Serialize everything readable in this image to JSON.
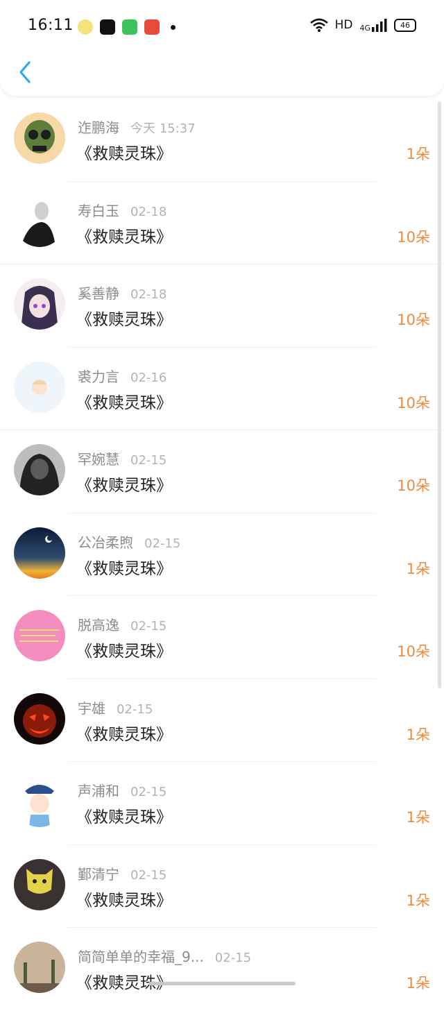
{
  "status_bar": {
    "time": "16:11",
    "hd": "HD",
    "network": "4G",
    "battery": "46"
  },
  "colors": {
    "accent": "#2aa8f2",
    "amount": "#f08a3a"
  },
  "records": [
    {
      "name": "迮鹏海",
      "date": "今天 15:37",
      "book": "《救赎灵珠》",
      "amount": "1朵"
    },
    {
      "name": "寿白玉",
      "date": "02-18",
      "book": "《救赎灵珠》",
      "amount": "10朵"
    },
    {
      "name": "奚善静",
      "date": "02-18",
      "book": "《救赎灵珠》",
      "amount": "10朵"
    },
    {
      "name": "裘力言",
      "date": "02-16",
      "book": "《救赎灵珠》",
      "amount": "10朵"
    },
    {
      "name": "罕婉慧",
      "date": "02-15",
      "book": "《救赎灵珠》",
      "amount": "10朵"
    },
    {
      "name": "公冶柔煦",
      "date": "02-15",
      "book": "《救赎灵珠》",
      "amount": "1朵"
    },
    {
      "name": "脱高逸",
      "date": "02-15",
      "book": "《救赎灵珠》",
      "amount": "10朵"
    },
    {
      "name": "宇雄",
      "date": "02-15",
      "book": "《救赎灵珠》",
      "amount": "1朵"
    },
    {
      "name": "声浦和",
      "date": "02-15",
      "book": "《救赎灵珠》",
      "amount": "1朵"
    },
    {
      "name": "鄞清宁",
      "date": "02-15",
      "book": "《救赎灵珠》",
      "amount": "1朵"
    },
    {
      "name": "简简单单的幸福_9...",
      "date": "02-15",
      "book": "《救赎灵珠》",
      "amount": "1朵"
    }
  ]
}
